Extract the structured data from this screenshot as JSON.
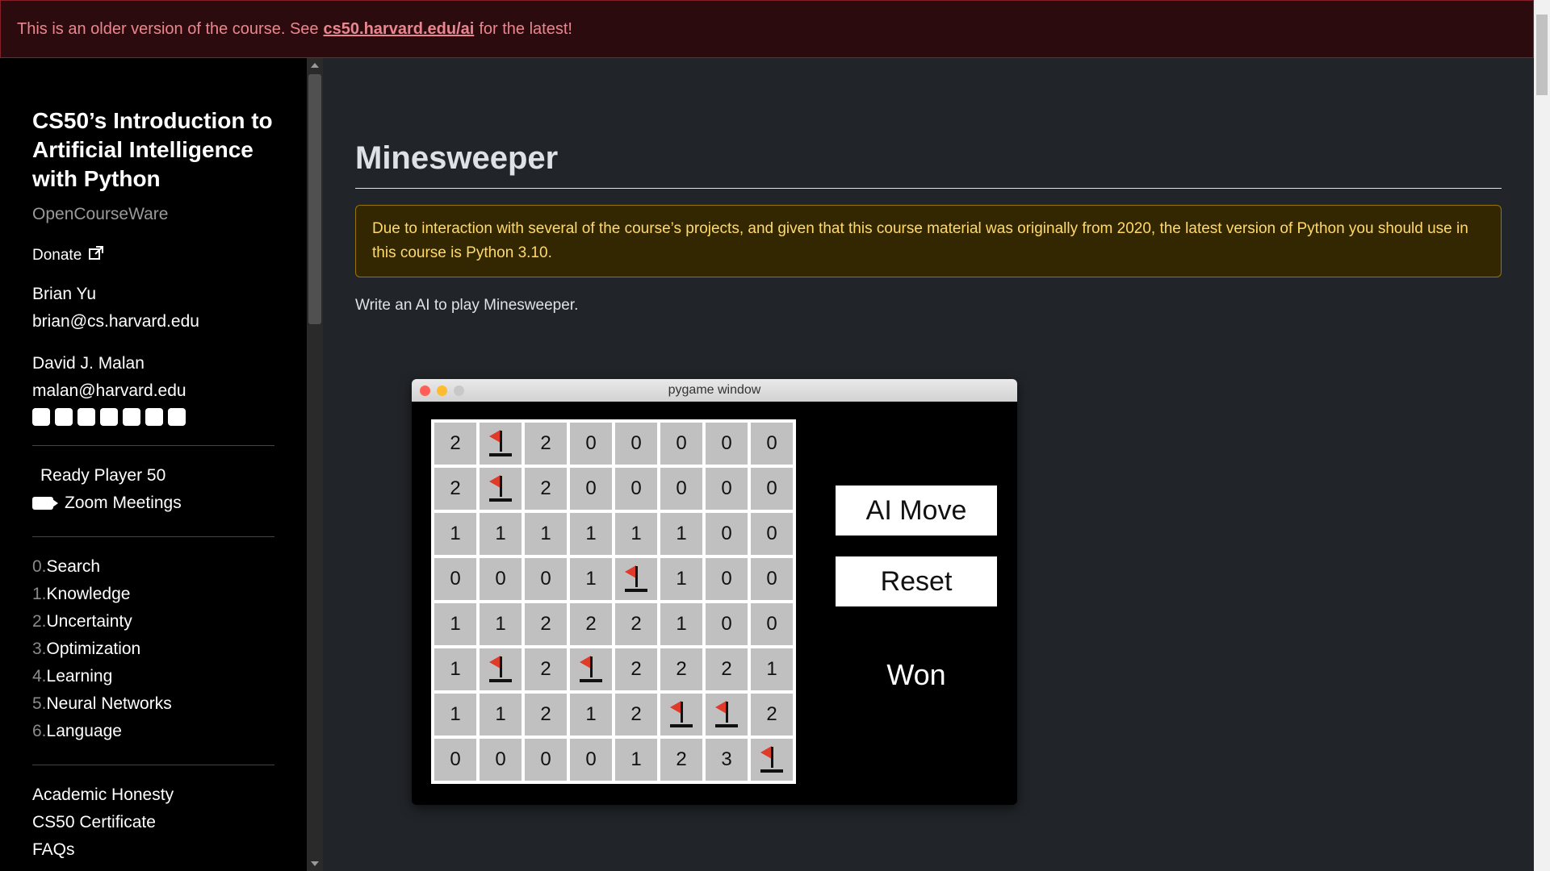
{
  "banner": {
    "prefix": "This is an older version of the course. See",
    "link": "cs50.harvard.edu/ai",
    "suffix": "for the latest!"
  },
  "sidebar": {
    "course_title": "CS50’s Introduction to Artificial Intelligence with Python",
    "subtitle": "OpenCourseWare",
    "donate": "Donate",
    "people": [
      {
        "name": "Brian Yu",
        "email": "brian@cs.harvard.edu"
      },
      {
        "name": "David J. Malan",
        "email": "malan@harvard.edu"
      }
    ],
    "social_icons": [
      "facebook-icon",
      "github-icon",
      "instagram-icon",
      "linkedin-icon",
      "reddit-icon",
      "threads-icon",
      "twitter-icon"
    ],
    "live": {
      "ready_player": "Ready Player 50",
      "zoom": "Zoom Meetings"
    },
    "lectures": [
      {
        "num": "0.",
        "label": "Search"
      },
      {
        "num": "1.",
        "label": "Knowledge"
      },
      {
        "num": "2.",
        "label": "Uncertainty"
      },
      {
        "num": "3.",
        "label": "Optimization"
      },
      {
        "num": "4.",
        "label": "Learning"
      },
      {
        "num": "5.",
        "label": "Neural Networks"
      },
      {
        "num": "6.",
        "label": "Language"
      }
    ],
    "misc": [
      "Academic Honesty",
      "CS50 Certificate",
      "FAQs"
    ]
  },
  "main": {
    "title": "Minesweeper",
    "warning": "Due to interaction with several of the course’s projects, and given that this course material was originally from 2020, the latest version of Python you should use in this course is Python 3.10.",
    "intro": "Write an AI to play Minesweeper."
  },
  "pygame": {
    "window_title": "pygame window",
    "ai_move": "AI Move",
    "reset": "Reset",
    "status": "Won",
    "board": [
      [
        "2",
        "F",
        "2",
        "0",
        "0",
        "0",
        "0",
        "0"
      ],
      [
        "2",
        "F",
        "2",
        "0",
        "0",
        "0",
        "0",
        "0"
      ],
      [
        "1",
        "1",
        "1",
        "1",
        "1",
        "1",
        "0",
        "0"
      ],
      [
        "0",
        "0",
        "0",
        "1",
        "F",
        "1",
        "0",
        "0"
      ],
      [
        "1",
        "1",
        "2",
        "2",
        "2",
        "1",
        "0",
        "0"
      ],
      [
        "1",
        "F",
        "2",
        "F",
        "2",
        "2",
        "2",
        "1"
      ],
      [
        "1",
        "1",
        "2",
        "1",
        "2",
        "F",
        "F",
        "2"
      ],
      [
        "0",
        "0",
        "0",
        "0",
        "1",
        "2",
        "3",
        "F"
      ]
    ]
  },
  "colors": {
    "banner_bg": "#2c0b0e",
    "banner_text": "#ea868f",
    "warn_bg": "#332701",
    "warn_text": "#ffda6a",
    "flag": "#e03a2a"
  }
}
